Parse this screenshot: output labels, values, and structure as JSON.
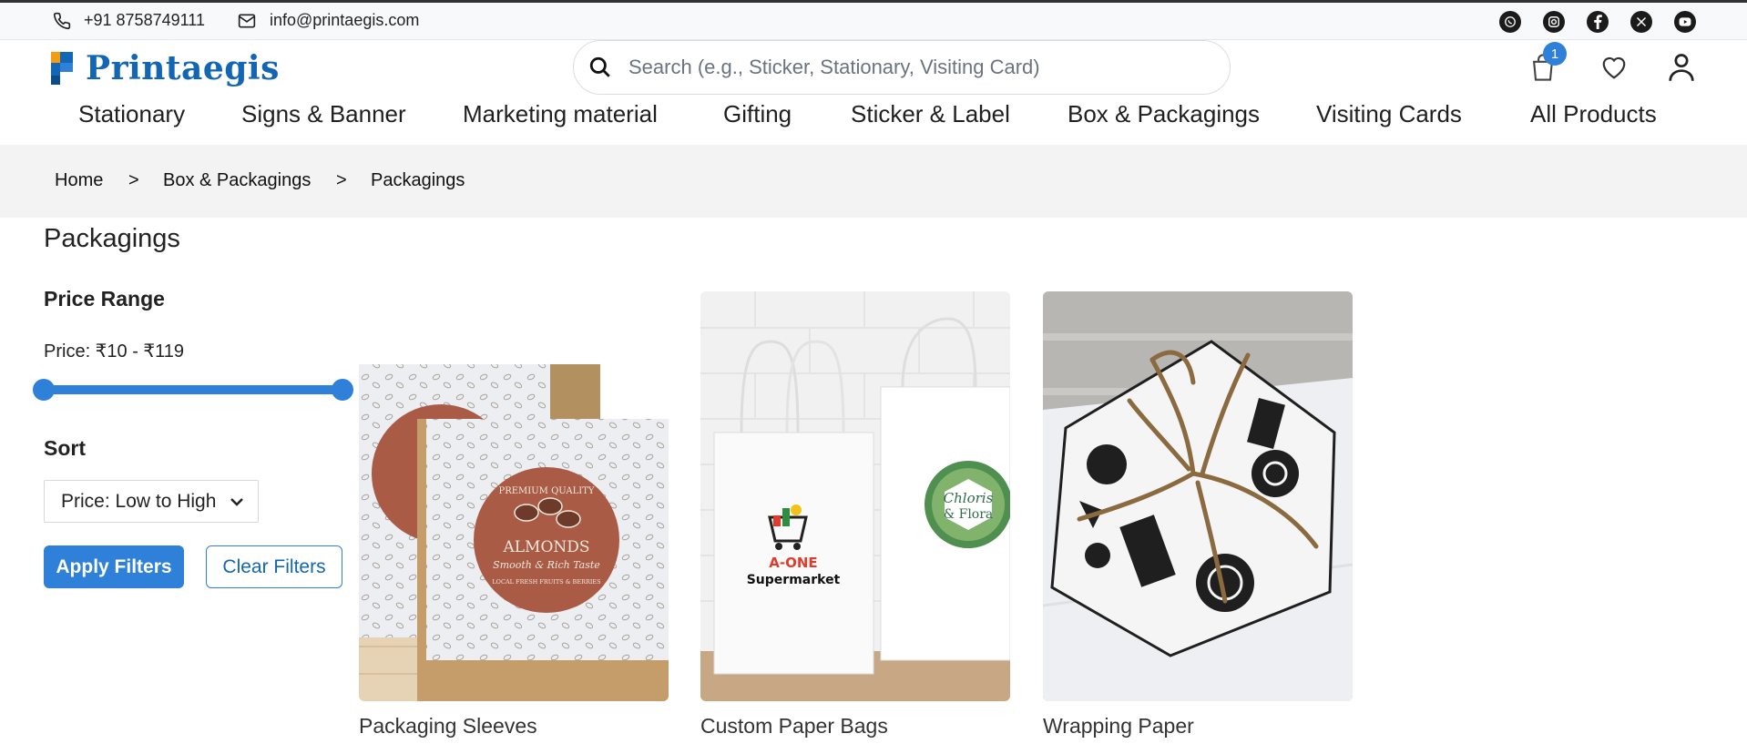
{
  "topbar": {
    "phone": "+91 8758749111",
    "email": "info@printaegis.com",
    "social_icons": [
      "whatsapp-icon",
      "instagram-icon",
      "facebook-icon",
      "x-icon",
      "youtube-icon"
    ]
  },
  "header": {
    "logo_text": "Printaegis",
    "search_placeholder": "Search (e.g., Sticker, Stationary, Visiting Card)",
    "cart_count": "1"
  },
  "nav": [
    "Stationary",
    "Signs & Banner",
    "Marketing material",
    "Gifting",
    "Sticker & Label",
    "Box & Packagings",
    "Visiting Cards",
    "All Products"
  ],
  "breadcrumb": {
    "items": [
      "Home",
      "Box & Packagings",
      "Packagings"
    ],
    "separator": ">"
  },
  "page_title": "Packagings",
  "filters": {
    "price_range_title": "Price Range",
    "price_text": "Price: ₹10 - ₹119",
    "sort_title": "Sort",
    "sort_value": "Price: Low to High",
    "apply_label": "Apply Filters",
    "clear_label": "Clear Filters"
  },
  "products": [
    {
      "name": "Packaging Sleeves",
      "label_line1": "PREMIUM QUALITY",
      "label_line2": "ALMONDS",
      "label_line3": "Smooth & Rich Taste",
      "label_line4": "LOCAL FRESH FRUITS & BERRIES"
    },
    {
      "name": "Custom Paper Bags",
      "bag_brand": "A-ONE",
      "bag_brand_sub": "Supermarket",
      "sticker_line1": "Chloris",
      "sticker_line2": "& Flora"
    },
    {
      "name": "Wrapping Paper"
    }
  ],
  "colors": {
    "accent": "#2f80d8",
    "brand": "#1266b4",
    "crumb_bg": "#f3f3f3"
  }
}
